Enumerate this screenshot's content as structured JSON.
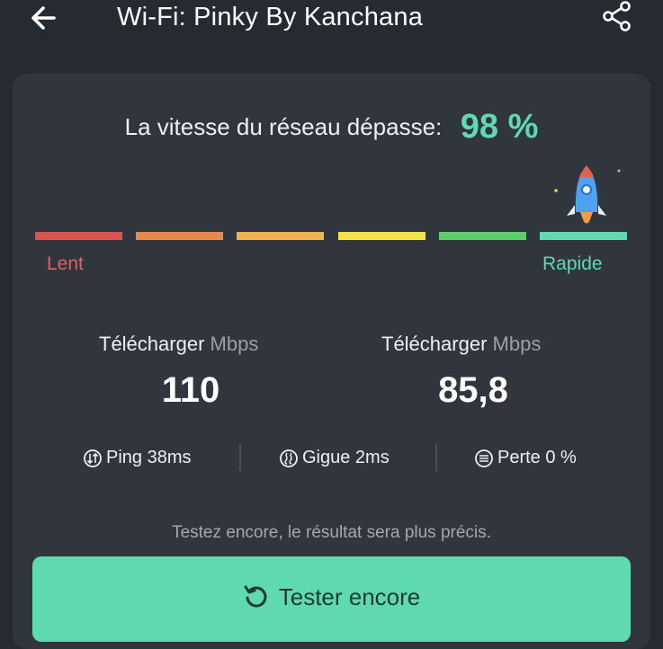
{
  "header": {
    "title": "Wi-Fi: Pinky By Kanchana",
    "back_icon": "arrow-left-icon",
    "share_icon": "share-icon"
  },
  "speed": {
    "label": "La vitesse du réseau dépasse:",
    "percent": "98 %"
  },
  "scale": {
    "slow_label": "Lent",
    "fast_label": "Rapide",
    "segments": [
      "#d9534f",
      "#e9884b",
      "#f0b24a",
      "#f3e24b",
      "#5cce6a",
      "#5fd9b0"
    ],
    "rocket_icon": "rocket-icon"
  },
  "download": {
    "label": "Télécharger",
    "unit": "Mbps",
    "value": "110"
  },
  "upload": {
    "label": "Télécharger",
    "unit": "Mbps",
    "value": "85,8"
  },
  "metrics": {
    "ping": "Ping 38ms",
    "jitter": "Gigue 2ms",
    "loss": "Perte 0 %"
  },
  "hint": "Testez encore, le résultat sera plus précis.",
  "retest": {
    "label": "Tester encore",
    "icon": "refresh-icon"
  },
  "colors": {
    "accent": "#5fd9b0",
    "background": "#262a31",
    "card": "#30353e"
  }
}
